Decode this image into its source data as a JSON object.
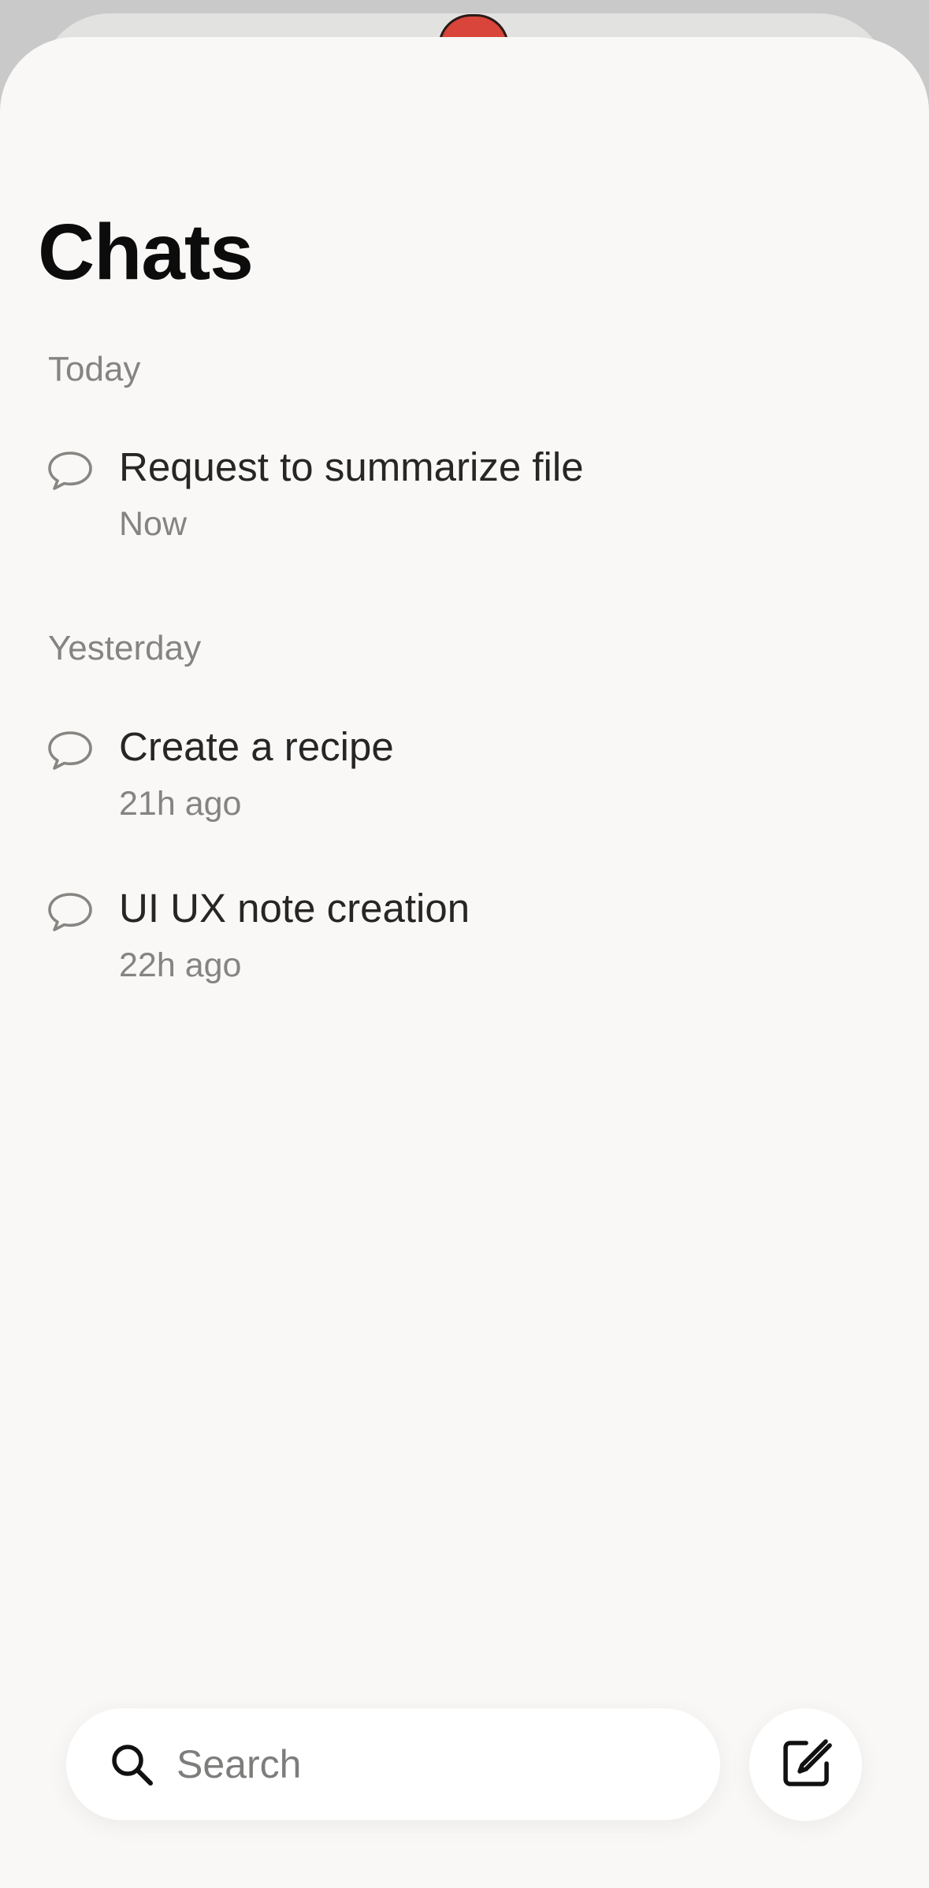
{
  "page": {
    "title": "Chats"
  },
  "sections": [
    {
      "header": "Today",
      "items": [
        {
          "title": "Request to summarize file",
          "time": "Now",
          "icon": "chat-bubble-icon"
        }
      ]
    },
    {
      "header": "Yesterday",
      "items": [
        {
          "title": "Create a recipe",
          "time": "21h ago",
          "icon": "chat-bubble-icon"
        },
        {
          "title": "UI UX note creation",
          "time": "22h ago",
          "icon": "chat-bubble-icon"
        }
      ]
    }
  ],
  "search": {
    "placeholder": "Search",
    "value": "",
    "icon": "search-icon"
  },
  "compose": {
    "icon": "compose-icon"
  },
  "colors": {
    "background": "#f9f8f6",
    "title": "#0c0c0c",
    "secondary_text": "#858482",
    "item_text": "#262626",
    "accent_blob": "#d9453a"
  }
}
